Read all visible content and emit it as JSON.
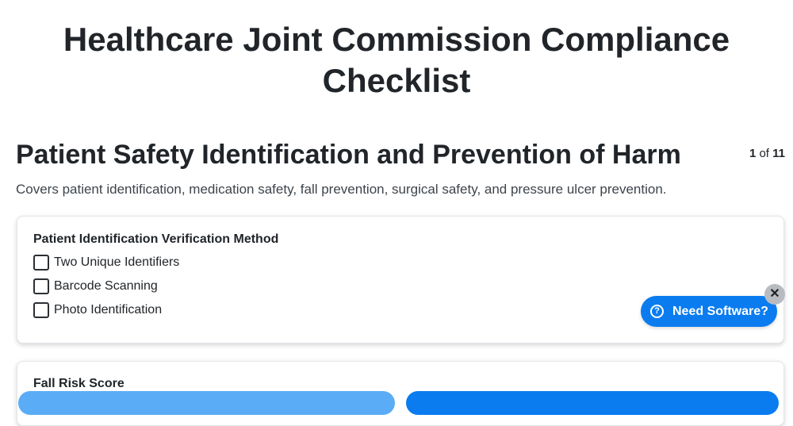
{
  "page": {
    "title": "Healthcare Joint Commission Compliance Checklist"
  },
  "section": {
    "title": "Patient Safety Identification and Prevention of Harm",
    "pager": {
      "current": "1",
      "of_label": "of",
      "total": "11"
    },
    "description": "Covers patient identification, medication safety, fall prevention, surgical safety, and pressure ulcer prevention."
  },
  "questions": [
    {
      "label": "Patient Identification Verification Method",
      "options": [
        {
          "label": "Two Unique Identifiers",
          "checked": false
        },
        {
          "label": "Barcode Scanning",
          "checked": false
        },
        {
          "label": "Photo Identification",
          "checked": false
        }
      ]
    },
    {
      "label": "Fall Risk Score"
    }
  ],
  "promo": {
    "button_label": "Need Software?",
    "help_icon": "help-circle-icon",
    "close_icon": "close-icon",
    "close_glyph": "✕",
    "help_glyph": "?"
  },
  "colors": {
    "primary": "#0a7cf0",
    "primary_light": "#5aacf6",
    "close_bg": "#b8bcc1",
    "text": "#212529"
  }
}
